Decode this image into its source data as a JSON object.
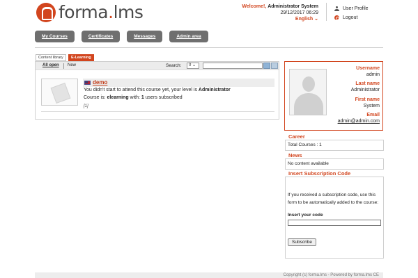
{
  "brand": {
    "name_part1": "forma",
    "name_dot": ".",
    "name_part2": "lms"
  },
  "header": {
    "welcome": "Welcome!,",
    "user": "Administrator System",
    "datetime": "29/12/2017 06:29",
    "language": "English ⌄",
    "user_profile": "User Profile",
    "logout": "Logout"
  },
  "nav": [
    "My Courses",
    "Certificates",
    "Messages",
    "Admin area"
  ],
  "tabs": {
    "content_library": "Content library",
    "elearning": "E-Learning"
  },
  "toolbar": {
    "all_open": "All open",
    "new": "New",
    "search_label": "Search:",
    "select_value": "0 ⌄"
  },
  "course": {
    "title": "demo",
    "line1_prefix": "You didn't start to attend this course yet, your level is ",
    "line1_level": "Administrator",
    "line2_prefix": "Course is: ",
    "line2_type": "elearning",
    "line2_mid": " with: ",
    "line2_count": "1",
    "line2_suffix": " users subscribed",
    "line3": "[1]"
  },
  "profile": {
    "username_label": "Username",
    "username": "admin",
    "lastname_label": "Last name",
    "lastname": "Administrator",
    "firstname_label": "First name",
    "firstname": "System",
    "email_label": "Email",
    "email": "admin@admin.com"
  },
  "career": {
    "title": "Career",
    "text": "Total Courses : 1"
  },
  "news": {
    "title": "News",
    "text": "No content available"
  },
  "subscription": {
    "title": "Insert Subscription Code",
    "text": "If you received a subscription code, use this form to be automatically added to the course:",
    "label": "Insert your code",
    "button": "Subscribe"
  },
  "footer": "Copyright (c) forma.lms - Powered by forma.lms CE",
  "colors": {
    "accent": "#d2451e",
    "nav": "#6f6f6f"
  }
}
